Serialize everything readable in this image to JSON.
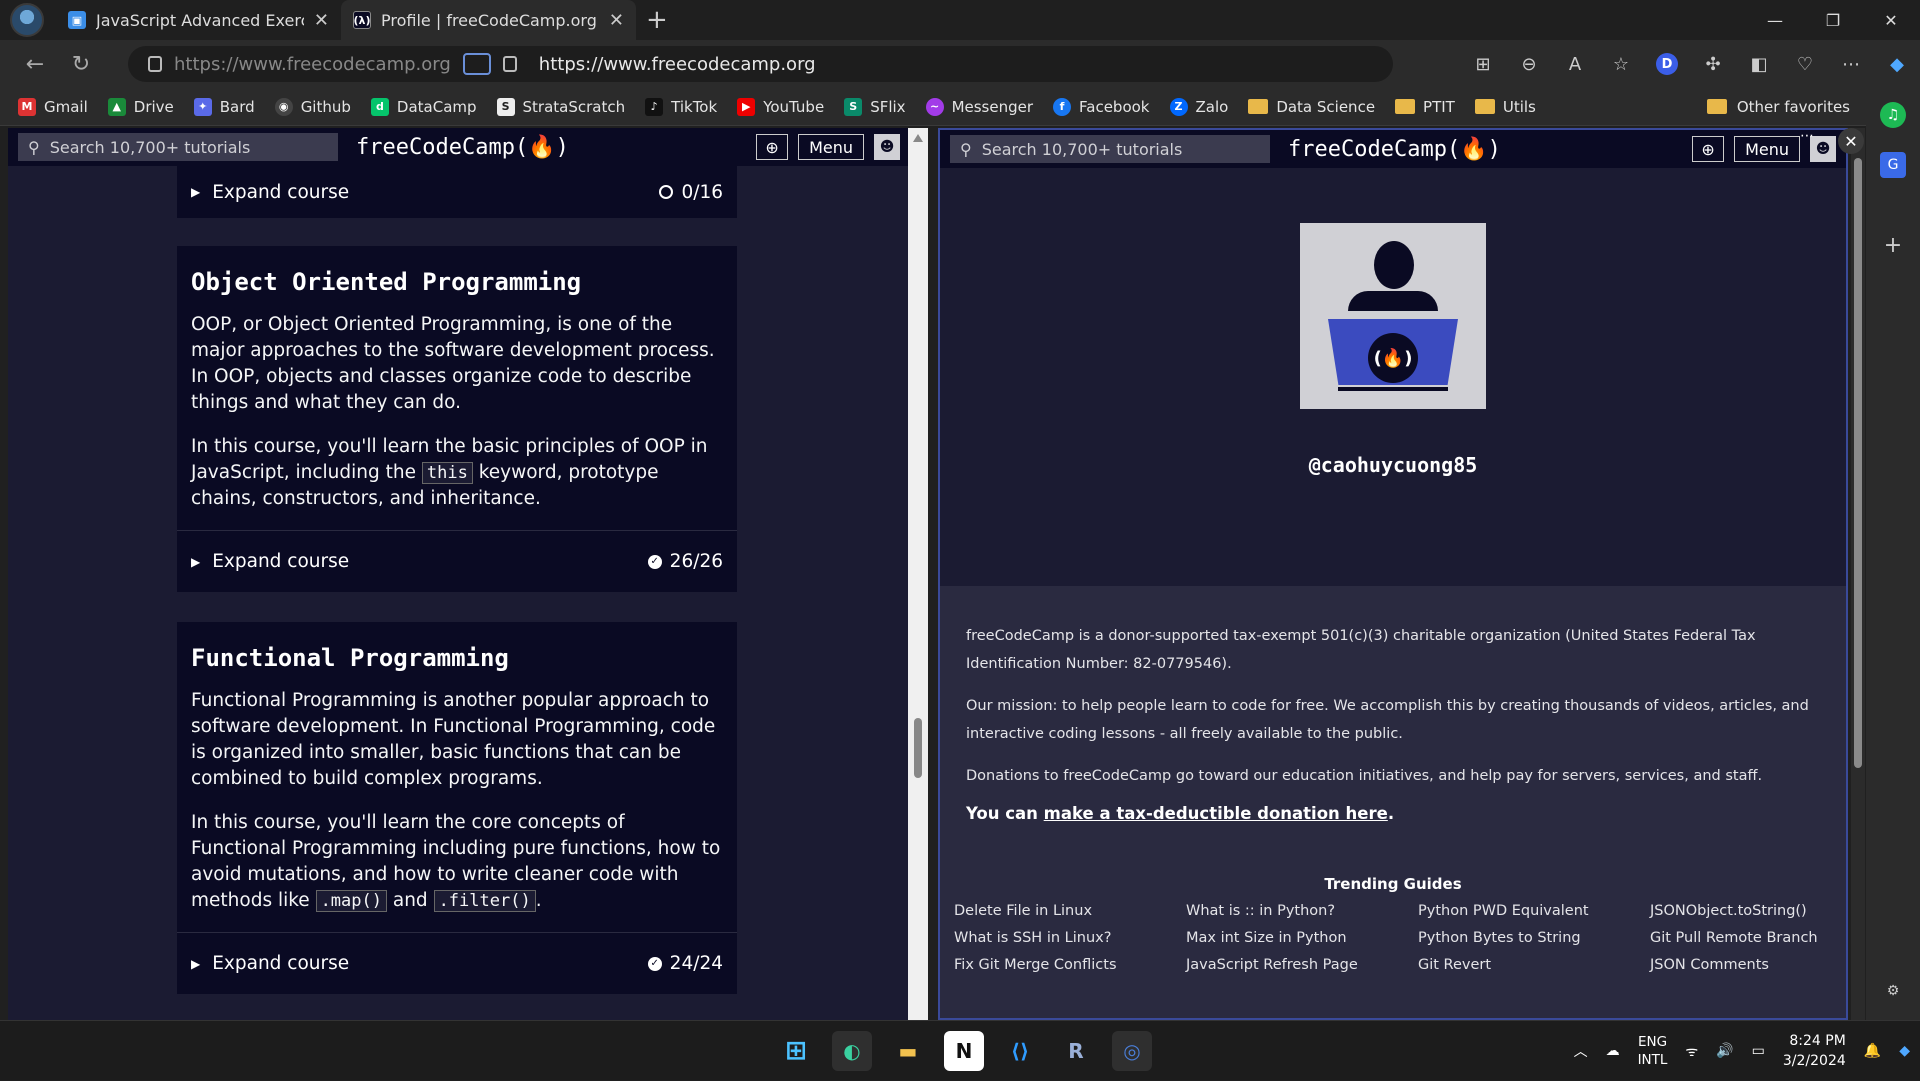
{
  "browser": {
    "tabs": [
      {
        "label": "JavaScript Advanced Exercise",
        "active": false
      },
      {
        "label": "Profile | freeCodeCamp.org",
        "active": true
      }
    ],
    "url_left": "https://www.freecodecamp.org",
    "url_right": "https://www.freecodecamp.org",
    "bookmarks": [
      "Gmail",
      "Drive",
      "Bard",
      "Github",
      "DataCamp",
      "StrataScratch",
      "TikTok",
      "YouTube",
      "SFlix",
      "Messenger",
      "Facebook",
      "Zalo",
      "Data Science",
      "PTIT",
      "Utils"
    ],
    "other_favorites": "Other favorites",
    "ext_letter": "D"
  },
  "fcc_nav": {
    "search_placeholder": "Search 10,700+ tutorials",
    "logo": "freeCodeCamp(🔥)",
    "menu": "Menu"
  },
  "left": {
    "top_expand": {
      "label": "Expand course",
      "progress": "0/16"
    },
    "courses": [
      {
        "title": "Object Oriented Programming",
        "p1": "OOP, or Object Oriented Programming, is one of the major approaches to the software development process. In OOP, objects and classes organize code to describe things and what they can do.",
        "p2_a": "In this course, you'll learn the basic principles of OOP in JavaScript, including the ",
        "p2_code": "this",
        "p2_b": " keyword, prototype chains, constructors, and inheritance.",
        "expand": "Expand course",
        "progress": "26/26"
      },
      {
        "title": "Functional Programming",
        "p1": "Functional Programming is another popular approach to software development. In Functional Programming, code is organized into smaller, basic functions that can be combined to build complex programs.",
        "p2_a": "In this course, you'll learn the core concepts of Functional Programming including pure functions, how to avoid mutations, and how to write cleaner code with methods like ",
        "p2_code1": ".map()",
        "p2_mid": " and ",
        "p2_code2": ".filter()",
        "p2_end": ".",
        "expand": "Expand course",
        "progress": "24/24"
      }
    ]
  },
  "right": {
    "username": "@caohuycuong85",
    "footer_p1": "freeCodeCamp is a donor-supported tax-exempt 501(c)(3) charitable organization (United States Federal Tax Identification Number: 82-0779546).",
    "footer_p2": "Our mission: to help people learn to code for free. We accomplish this by creating thousands of videos, articles, and interactive coding lessons - all freely available to the public.",
    "footer_p3": "Donations to freeCodeCamp go toward our education initiatives, and help pay for servers, services, and staff.",
    "donate_prefix": "You can ",
    "donate_link": "make a tax-deductible donation here",
    "donate_suffix": ".",
    "trending_title": "Trending Guides",
    "trending": [
      "Delete File in Linux",
      "What is :: in Python?",
      "Python PWD Equivalent",
      "JSONObject.toString()",
      "What is SSH in Linux?",
      "Max int Size in Python",
      "Python Bytes to String",
      "Git Pull Remote Branch",
      "Fix Git Merge Conflicts",
      "JavaScript Refresh Page",
      "Git Revert",
      "JSON Comments"
    ]
  },
  "taskbar": {
    "lang1": "ENG",
    "lang2": "INTL",
    "time": "8:24 PM",
    "date": "3/2/2024"
  },
  "colors": {
    "fcc_dark": "#0a0a23",
    "fcc_bg": "#1b1b32",
    "fcc_footer": "#2a2a40"
  }
}
